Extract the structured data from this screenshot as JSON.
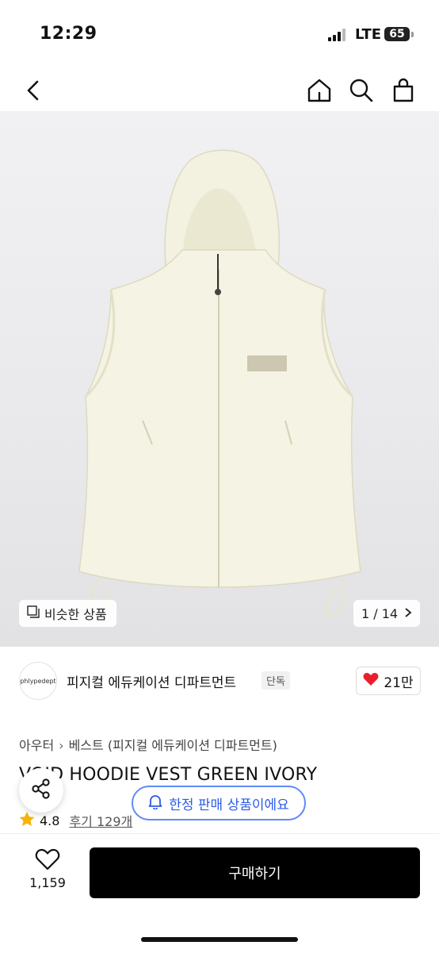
{
  "status": {
    "time": "12:29",
    "network": "LTE",
    "battery": "65"
  },
  "nav": {
    "back_icon": "chevron-left-icon",
    "home_icon": "home-icon",
    "search_icon": "search-icon",
    "cart_icon": "shopping-bag-icon"
  },
  "gallery": {
    "similar_label": "비슷한 상품",
    "counter": "1 / 14"
  },
  "brand": {
    "logo_text": "phlypedept",
    "name": "피지컬 에듀케이션 디파트먼트",
    "badge": "단독",
    "likes": "21만"
  },
  "breadcrumb": {
    "category": "아우터",
    "subcategory": "베스트 (피지컬 에듀케이션 디파트먼트)"
  },
  "product": {
    "title": "VOID HOODIE VEST GREEN IVORY",
    "rating": "4.8",
    "reviews": "후기 129개"
  },
  "floating": {
    "limited_label": "한정 판매 상품이에요"
  },
  "bottom": {
    "wish_count": "1,159",
    "buy_label": "구매하기"
  },
  "colors": {
    "accent_blue": "#2d5be8",
    "heart_red": "#e8202e",
    "star_yellow": "#f5b400",
    "buy_bg": "#000000"
  }
}
